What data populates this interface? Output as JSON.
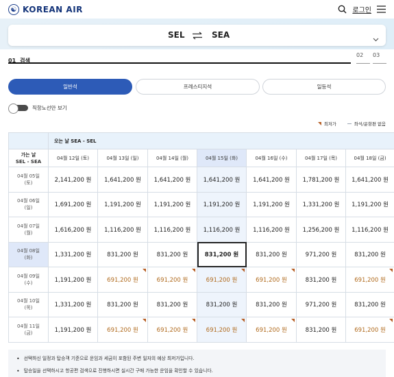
{
  "header": {
    "brand": "KOREAN AIR",
    "login_label": "로그인"
  },
  "route": {
    "from": "SEL",
    "to": "SEA"
  },
  "steps": {
    "step1_num": "01",
    "step1_label": "검색",
    "step2_num": "02",
    "step3_num": "03"
  },
  "cabin_tabs": [
    "일반석",
    "프레스티지석",
    "일등석"
  ],
  "toggle_label": "직항노선만 보기",
  "legend": {
    "lowest": "최저가",
    "unavailable": "좌석/운항편 없음"
  },
  "table": {
    "header_label": "오는 날 SEA - SEL",
    "corner_line1": "가는 날",
    "corner_line2": "SEL - SEA",
    "col_dates": [
      "04월 12일 (토)",
      "04월 13일 (일)",
      "04월 14일 (월)",
      "04월 15일 (화)",
      "04월 16일 (수)",
      "04월 17일 (목)",
      "04월 18일 (금)"
    ],
    "rows": [
      {
        "date1": "04월 05일",
        "date2": "(토)",
        "fares": [
          "2,141,200 원",
          "1,641,200 원",
          "1,641,200 원",
          "1,641,200 원",
          "1,641,200 원",
          "1,781,200 원",
          "1,641,200 원"
        ]
      },
      {
        "date1": "04월 06일",
        "date2": "(일)",
        "fares": [
          "1,691,200 원",
          "1,191,200 원",
          "1,191,200 원",
          "1,191,200 원",
          "1,191,200 원",
          "1,331,200 원",
          "1,191,200 원"
        ]
      },
      {
        "date1": "04월 07일",
        "date2": "(월)",
        "fares": [
          "1,616,200 원",
          "1,116,200 원",
          "1,116,200 원",
          "1,116,200 원",
          "1,116,200 원",
          "1,256,200 원",
          "1,116,200 원"
        ]
      },
      {
        "date1": "04월 08일",
        "date2": "(화)",
        "fares": [
          "1,331,200 원",
          "831,200 원",
          "831,200 원",
          "831,200 원",
          "831,200 원",
          "971,200 원",
          "831,200 원"
        ]
      },
      {
        "date1": "04월 09일",
        "date2": "(수)",
        "fares": [
          "1,191,200 원",
          "691,200 원",
          "691,200 원",
          "691,200 원",
          "691,200 원",
          "831,200 원",
          "691,200 원"
        ]
      },
      {
        "date1": "04월 10일",
        "date2": "(목)",
        "fares": [
          "1,331,200 원",
          "831,200 원",
          "831,200 원",
          "831,200 원",
          "831,200 원",
          "971,200 원",
          "831,200 원"
        ]
      },
      {
        "date1": "04월 11일",
        "date2": "(금)",
        "fares": [
          "1,191,200 원",
          "691,200 원",
          "691,200 원",
          "691,200 원",
          "691,200 원",
          "831,200 원",
          "691,200 원"
        ]
      }
    ]
  },
  "notes": [
    "선택하신 일정과 탑승객 기준으로 운임과 세금이 포함된 주변 일자의 예상 최저가입니다.",
    "탑승일을 선택하시고 항공편 검색으로 진행하시면 실시간 구매 가능한 운임을 확인할 수 있습니다."
  ],
  "colors": {
    "accent": "#2d5bb7",
    "lowest_fare": "#b06a1d",
    "header_bg": "#e8f2fb"
  }
}
